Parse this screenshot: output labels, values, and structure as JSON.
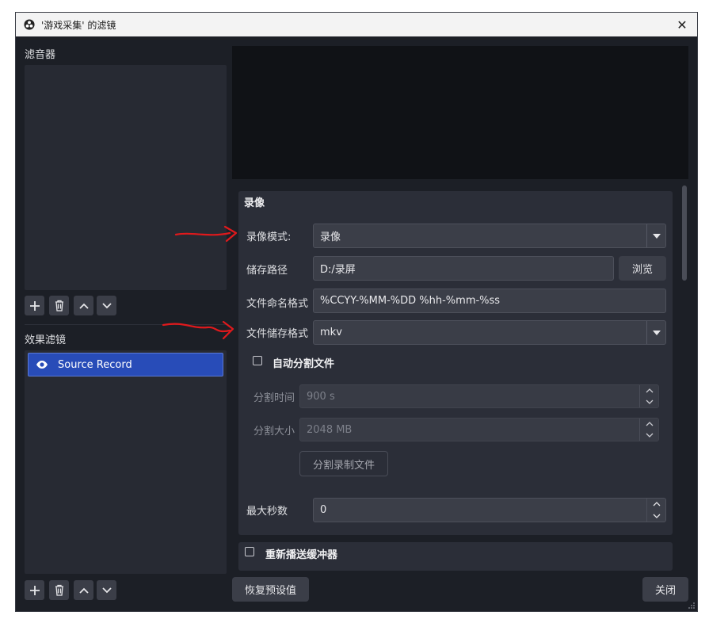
{
  "window": {
    "title": "'游戏采集' 的滤镜",
    "close_glyph": "✕"
  },
  "left": {
    "audio_filters_label": "滤音器",
    "effect_filters_label": "效果滤镜",
    "effect_filters": [
      {
        "name": "Source Record",
        "selected": true,
        "visible": true
      }
    ],
    "toolbar_icons": [
      "plus-icon",
      "trash-icon",
      "arrow-up-icon",
      "arrow-down-icon"
    ]
  },
  "record": {
    "section_title": "录像",
    "mode_label": "录像模式:",
    "mode_value": "录像",
    "path_label": "储存路径",
    "path_value": "D:/录屏",
    "browse_label": "浏览",
    "naming_label": "文件命名格式",
    "naming_value": "%CCYY-%MM-%DD %hh-%mm-%ss",
    "format_label": "文件储存格式",
    "format_value": "mkv",
    "auto_split_label": "自动分割文件",
    "auto_split_checked": false,
    "split_time_label": "分割时间",
    "split_time_value": "900 s",
    "split_size_label": "分割大小",
    "split_size_value": "2048 MB",
    "split_button_label": "分割录制文件",
    "max_seconds_label": "最大秒数",
    "max_seconds_value": "0"
  },
  "replay": {
    "title": "重新播送缓冲器",
    "checked": false
  },
  "footer": {
    "reset_label": "恢复预设值",
    "close_label": "关闭"
  },
  "colors": {
    "window_bg": "#1c1f26",
    "panel_bg": "#2b2e38",
    "selection": "#284cb8",
    "annotation_arrow": "#e0191c"
  }
}
